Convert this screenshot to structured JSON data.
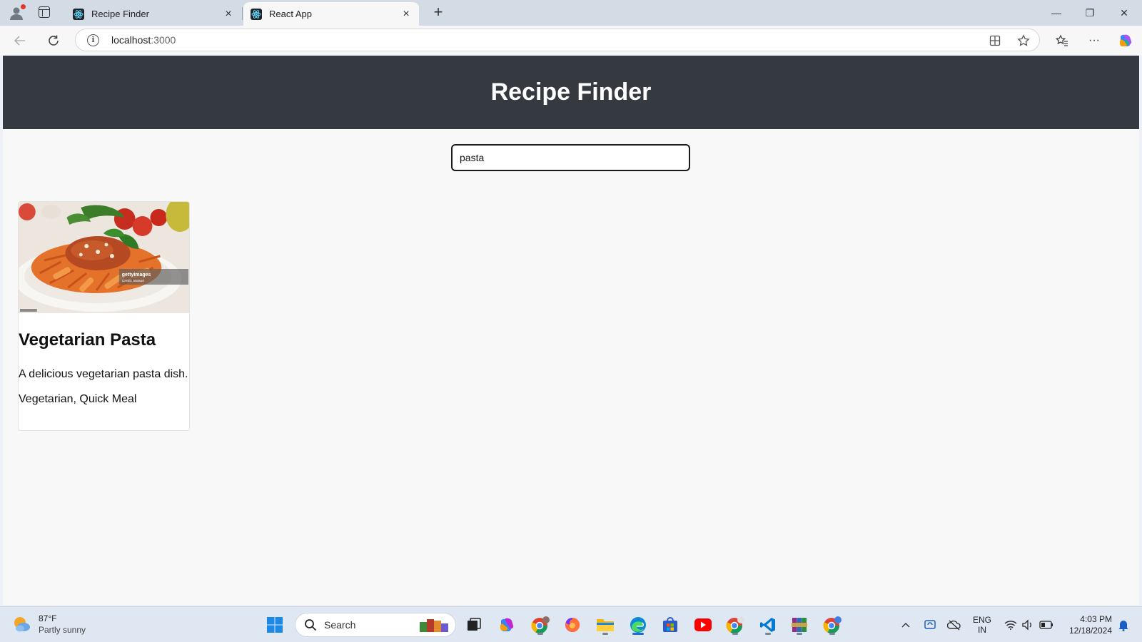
{
  "browser": {
    "tabs": [
      {
        "title": "Recipe Finder",
        "active": false
      },
      {
        "title": "React App",
        "active": true
      }
    ],
    "new_tab_label": "+",
    "address": {
      "host": "localhost",
      "port": ":3000"
    },
    "window_controls": {
      "minimize": "—",
      "restore": "❐",
      "close": "✕"
    }
  },
  "page": {
    "header_title": "Recipe Finder",
    "search": {
      "value": "pasta",
      "placeholder": ""
    },
    "recipes": [
      {
        "title": "Vegetarian Pasta",
        "description": "A delicious vegetarian pasta dish.",
        "tags": "Vegetarian, Quick Meal",
        "image_watermark": "gettyimages",
        "image_credit": "Credit: kiwauri"
      }
    ]
  },
  "taskbar": {
    "weather": {
      "temp": "87°F",
      "condition": "Partly sunny"
    },
    "search_placeholder": "Search",
    "language": {
      "line1": "ENG",
      "line2": "IN"
    },
    "clock": {
      "time": "4:03 PM",
      "date": "12/18/2024"
    }
  },
  "colors": {
    "header_bg": "#353a41",
    "page_bg": "#f8f8f8",
    "accent": "#1a6fd1"
  }
}
